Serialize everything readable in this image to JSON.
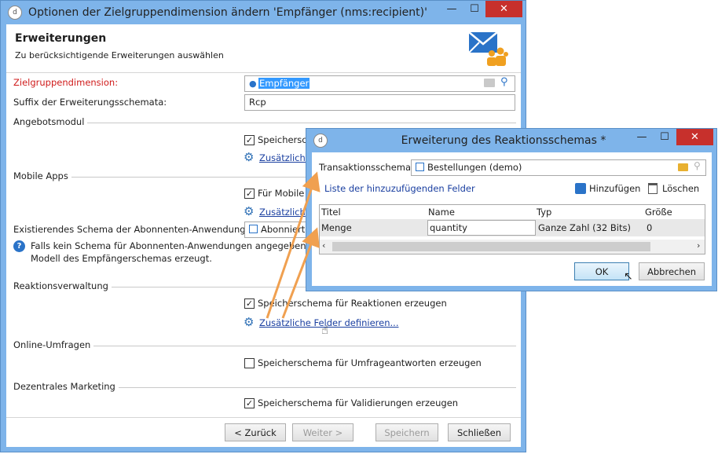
{
  "main": {
    "title": "Optionen der Zielgruppendimension ändern 'Empfänger (nms:recipient)'",
    "minimize": "—",
    "maximize": "☐",
    "close": "✕",
    "app_glyph": "d",
    "header_title": "Erweiterungen",
    "header_sub": "Zu berücksichtigende Erweiterungen auswählen",
    "target_dim_label": "Zielgruppendimension:",
    "target_dim_value": "Empfänger",
    "suffix_label": "Suffix der Erweiterungsschemata:",
    "suffix_value": "Rcp",
    "sections": {
      "offer": "Angebotsmodul",
      "mobile": "Mobile Apps",
      "reaction": "Reaktionsverwaltung",
      "survey": "Online-Umfragen",
      "decentral": "Dezentrales Marketing"
    },
    "offer_checkbox": "Speichersch",
    "offer_link": "Zusätzliche",
    "mobile_checkbox": "Für Mobile A",
    "mobile_link": "Zusätzlich",
    "existing_schema_label": "Existierendes Schema der Abonnenten-Anwendungen:",
    "existing_schema_value": "Abonnierte",
    "info_text_1": "Falls kein Schema für Abonnenten-Anwendungen angegeben wird",
    "info_text_2": "Modell des Empfängerschemas erzeugt.",
    "reaction_checkbox": "Speicherschema für Reaktionen erzeugen",
    "reaction_link": "Zusätzliche Felder definieren...",
    "survey_checkbox": "Speicherschema für Umfrageantworten erzeugen",
    "decentral_checkbox": "Speicherschema für Validierungen erzeugen",
    "buttons": {
      "back": "< Zurück",
      "next": "Weiter >",
      "save": "Speichern",
      "close": "Schließen"
    }
  },
  "dialog": {
    "title": "Erweiterung des Reaktionsschemas *",
    "minimize": "—",
    "maximize": "☐",
    "close": "✕",
    "app_glyph": "d",
    "transaction_label": "Transaktionsschema:",
    "transaction_value": "Bestellungen (demo)",
    "list_title": "Liste der hinzuzufügenden Felder",
    "add_label": "Hinzufügen",
    "delete_label": "Löschen",
    "columns": [
      "Titel",
      "Name",
      "Typ",
      "Größe"
    ],
    "row": {
      "titel": "Menge",
      "name": "quantity",
      "typ": "Ganze Zahl (32 Bits)",
      "groesse": "0"
    },
    "ok": "OK",
    "cancel": "Abbrechen"
  },
  "colors": {
    "accent": "#7eb4ea",
    "close": "#c7302c",
    "link": "#1a3fa0",
    "arrow": "#f0a050",
    "required": "#d01b1b"
  }
}
